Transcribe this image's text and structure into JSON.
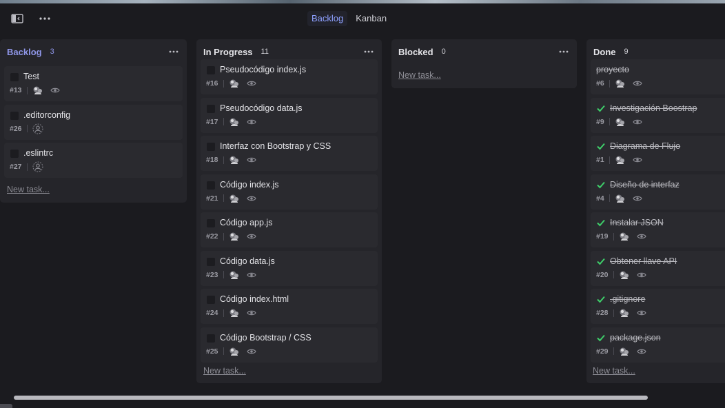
{
  "view_tabs": [
    {
      "label": "Backlog",
      "active": true
    },
    {
      "label": "Kanban",
      "active": false
    }
  ],
  "columns": {
    "backlog": {
      "title": "Backlog",
      "count": "3",
      "new_task": "New task...",
      "cards": [
        {
          "title": "Test",
          "num": "#13"
        },
        {
          "title": ".editorconfig",
          "num": "#26"
        },
        {
          "title": ".eslintrc",
          "num": "#27"
        }
      ]
    },
    "in_progress": {
      "title": "In Progress",
      "count": "11",
      "new_task": "New task...",
      "cards": [
        {
          "title": "Pseudocódigo index.js",
          "num": "#16"
        },
        {
          "title": "Pseudocódigo data.js",
          "num": "#17"
        },
        {
          "title": "Interfaz con Bootstrap y CSS",
          "num": "#18"
        },
        {
          "title": "Código index.js",
          "num": "#21"
        },
        {
          "title": "Código app.js",
          "num": "#22"
        },
        {
          "title": "Código data.js",
          "num": "#23"
        },
        {
          "title": "Código index.html",
          "num": "#24"
        },
        {
          "title": "Código Bootstrap / CSS",
          "num": "#25"
        }
      ]
    },
    "blocked": {
      "title": "Blocked",
      "count": "0",
      "new_task": "New task..."
    },
    "done": {
      "title": "Done",
      "count": "9",
      "new_task": "New task...",
      "cards": [
        {
          "title": "proyecto",
          "num": "#6"
        },
        {
          "title": "Investigación Boostrap",
          "num": "#9"
        },
        {
          "title": "Diagrama de Flujo",
          "num": "#1"
        },
        {
          "title": "Diseño de interfaz",
          "num": "#4"
        },
        {
          "title": "Instalar JSON",
          "num": "#19"
        },
        {
          "title": "Obtener llave API",
          "num": "#20"
        },
        {
          "title": ".gitignore",
          "num": "#28"
        },
        {
          "title": "package.json",
          "num": "#29"
        }
      ]
    }
  },
  "colors": {
    "accent": "#8f96e8",
    "done_check": "#3ecf6a"
  }
}
